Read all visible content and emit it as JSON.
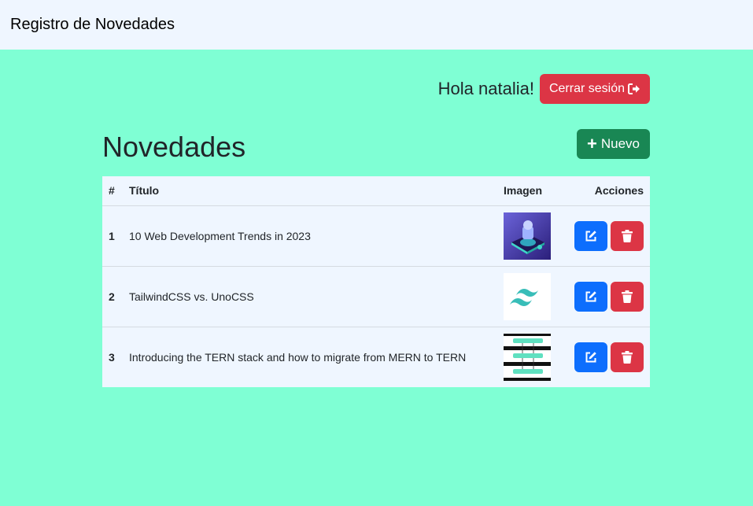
{
  "navbar": {
    "brand": "Registro de Novedades"
  },
  "header": {
    "greeting": "Hola natalia!",
    "logout_label": "Cerrar sesión",
    "page_title": "Novedades",
    "new_label": "Nuevo"
  },
  "table": {
    "columns": [
      "#",
      "Título",
      "Imagen",
      "Acciones"
    ],
    "rows": [
      {
        "id": "1",
        "title": "10 Web Development Trends in 2023",
        "image": "isometric-tech-thumbnail"
      },
      {
        "id": "2",
        "title": "TailwindCSS vs. UnoCSS",
        "image": "tailwind-logo-thumbnail"
      },
      {
        "id": "3",
        "title": "Introducing the TERN stack and how to migrate from MERN to TERN",
        "image": "stack-diagram-thumbnail"
      }
    ]
  },
  "icons": {
    "logout": "sign-out-icon",
    "new": "plus-icon",
    "edit": "edit-icon",
    "delete": "trash-icon"
  },
  "colors": {
    "page_bg": "#7fffd4",
    "nav_bg": "#eff6ff",
    "danger": "#dc3545",
    "success": "#198754",
    "primary": "#0d6efd"
  }
}
